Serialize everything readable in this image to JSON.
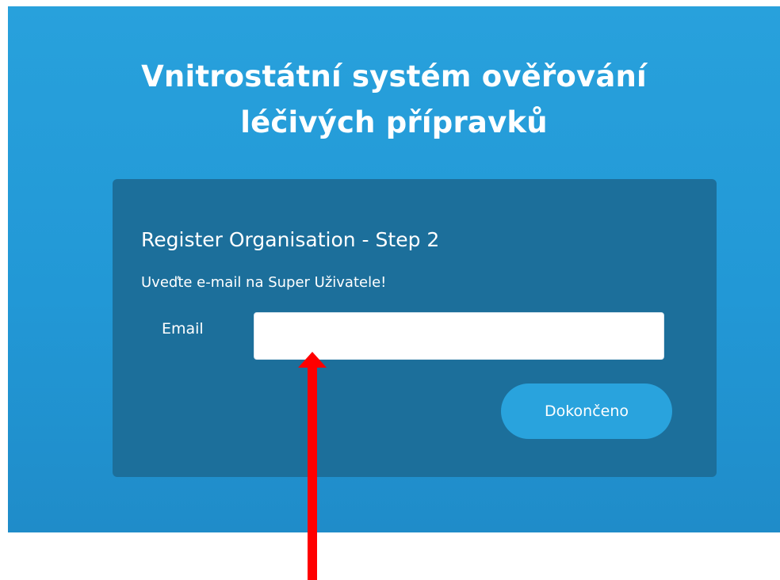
{
  "header": {
    "title_line1": "Vnitrostátní systém ověřování",
    "title_line2": "léčivých přípravků"
  },
  "form": {
    "heading": "Register Organisation - Step 2",
    "instruction": "Uveďte e-mail na Super Uživatele!",
    "email_label": "Email",
    "email_value": "",
    "submit_label": "Dokončeno"
  },
  "colors": {
    "banner": "#2298d6",
    "card": "#1c6f9b",
    "button": "#29a3dd",
    "annotation_arrow": "#ff0000"
  },
  "annotation": {
    "icon": "red-arrow-up-icon"
  }
}
